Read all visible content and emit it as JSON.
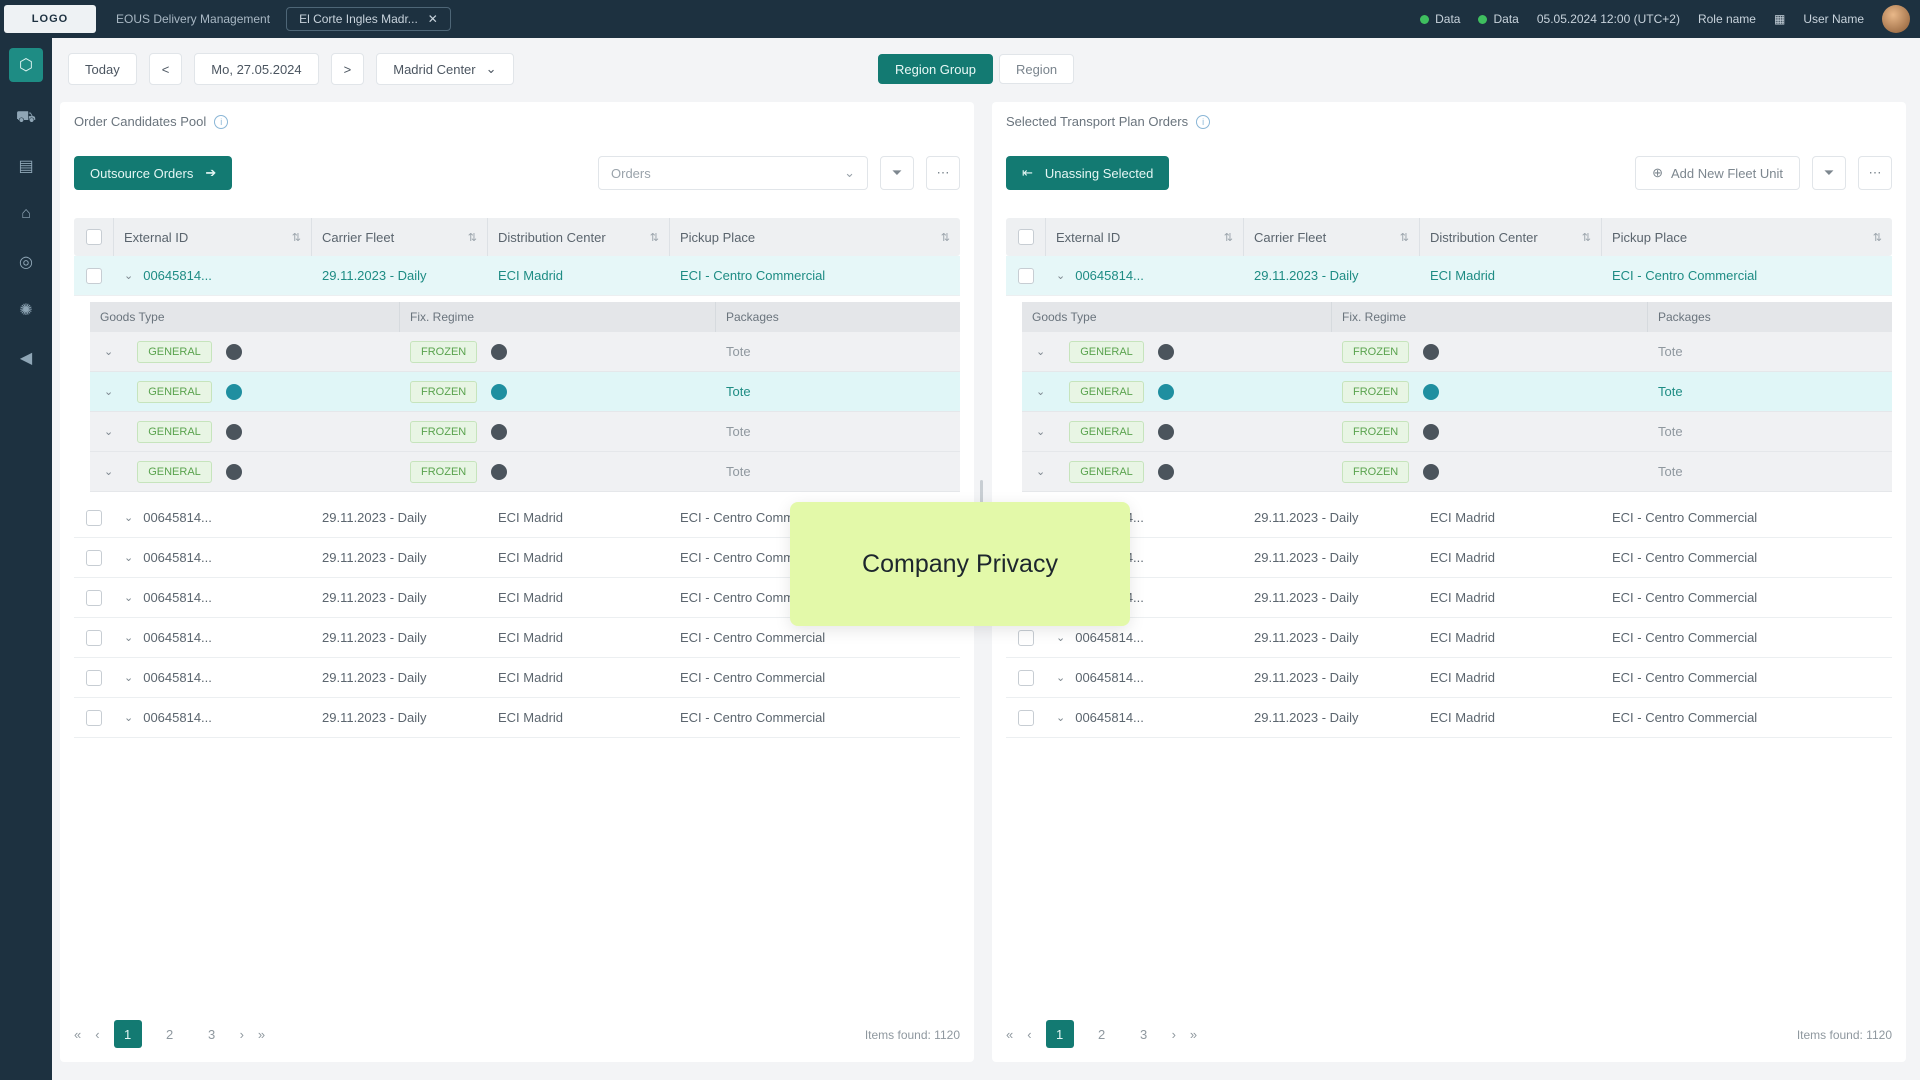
{
  "topbar": {
    "logo": "LOGO",
    "app_title": "EOUS Delivery Management",
    "context": "El Corte Ingles Madr...",
    "statuses": [
      "Data",
      "Data"
    ],
    "datetime": "05.05.2024 12:00 (UTC+2)",
    "role": "Role name",
    "user": "User Name"
  },
  "nav": [
    "home",
    "truck",
    "document",
    "tag",
    "settings",
    "gear",
    "megaphone"
  ],
  "toolbar": {
    "today": "Today",
    "prev": "<",
    "date": "Mo, 27.05.2024",
    "next": ">",
    "center": "Madrid Center",
    "seg_active": "Region Group",
    "seg_other": "Region"
  },
  "left": {
    "title": "Order Candidates Pool",
    "action": "Outsource Orders",
    "select_placeholder": "Orders",
    "columns": [
      "External ID",
      "Carrier Fleet",
      "Distribution Center",
      "Pickup Place"
    ],
    "sub_columns": [
      "Goods Type",
      "Fix. Regime",
      "Packages"
    ],
    "rows": [
      {
        "id": "00645814...",
        "carrier": "29.11.2023 - Daily",
        "dc": "ECI Madrid",
        "pickup": "ECI - Centro Commercial"
      },
      {
        "id": "00645814...",
        "carrier": "29.11.2023 - Daily",
        "dc": "ECI Madrid",
        "pickup": "ECI - Centro Commercial"
      },
      {
        "id": "00645814...",
        "carrier": "29.11.2023 - Daily",
        "dc": "ECI Madrid",
        "pickup": "ECI - Centro Commercial"
      },
      {
        "id": "00645814...",
        "carrier": "29.11.2023 - Daily",
        "dc": "ECI Madrid",
        "pickup": "ECI - Centro Commercial"
      },
      {
        "id": "00645814...",
        "carrier": "29.11.2023 - Daily",
        "dc": "ECI Madrid",
        "pickup": "ECI - Centro Commercial"
      },
      {
        "id": "00645814...",
        "carrier": "29.11.2023 - Daily",
        "dc": "ECI Madrid",
        "pickup": "ECI - Centro Commercial"
      },
      {
        "id": "00645814...",
        "carrier": "29.11.2023 - Daily",
        "dc": "ECI Madrid",
        "pickup": "ECI - Centro Commercial"
      }
    ],
    "sub_rows": [
      {
        "goods": "GENERAL",
        "regime": "FROZEN",
        "packages": "Tote"
      },
      {
        "goods": "GENERAL",
        "regime": "FROZEN",
        "packages": "Tote"
      },
      {
        "goods": "GENERAL",
        "regime": "FROZEN",
        "packages": "Tote"
      },
      {
        "goods": "GENERAL",
        "regime": "FROZEN",
        "packages": "Tote"
      }
    ],
    "pages": [
      "1",
      "2",
      "3"
    ],
    "items_found": "Items found: 1120"
  },
  "right": {
    "title": "Selected Transport Plan Orders",
    "action": "Unassing Selected",
    "add_label": "Add New Fleet Unit",
    "columns": [
      "External ID",
      "Carrier Fleet",
      "Distribution Center",
      "Pickup Place"
    ],
    "sub_columns": [
      "Goods Type",
      "Fix. Regime",
      "Packages"
    ],
    "rows": [
      {
        "id": "00645814...",
        "carrier": "29.11.2023 - Daily",
        "dc": "ECI Madrid",
        "pickup": "ECI - Centro Commercial"
      },
      {
        "id": "00645814...",
        "carrier": "29.11.2023 - Daily",
        "dc": "ECI Madrid",
        "pickup": "ECI - Centro Commercial"
      },
      {
        "id": "00645814...",
        "carrier": "29.11.2023 - Daily",
        "dc": "ECI Madrid",
        "pickup": "ECI - Centro Commercial"
      },
      {
        "id": "00645814...",
        "carrier": "29.11.2023 - Daily",
        "dc": "ECI Madrid",
        "pickup": "ECI - Centro Commercial"
      },
      {
        "id": "00645814...",
        "carrier": "29.11.2023 - Daily",
        "dc": "ECI Madrid",
        "pickup": "ECI - Centro Commercial"
      },
      {
        "id": "00645814...",
        "carrier": "29.11.2023 - Daily",
        "dc": "ECI Madrid",
        "pickup": "ECI - Centro Commercial"
      },
      {
        "id": "00645814...",
        "carrier": "29.11.2023 - Daily",
        "dc": "ECI Madrid",
        "pickup": "ECI - Centro Commercial"
      }
    ],
    "sub_rows": [
      {
        "goods": "GENERAL",
        "regime": "FROZEN",
        "packages": "Tote"
      },
      {
        "goods": "GENERAL",
        "regime": "FROZEN",
        "packages": "Tote"
      },
      {
        "goods": "GENERAL",
        "regime": "FROZEN",
        "packages": "Tote"
      },
      {
        "goods": "GENERAL",
        "regime": "FROZEN",
        "packages": "Tote"
      }
    ],
    "pages": [
      "1",
      "2",
      "3"
    ],
    "items_found": "Items found: 1120"
  },
  "overlay": "Company Privacy",
  "colors": {
    "accent": "#137a72",
    "nav_bg": "#1d3140",
    "privacy_bg": "#e3f9a9"
  }
}
